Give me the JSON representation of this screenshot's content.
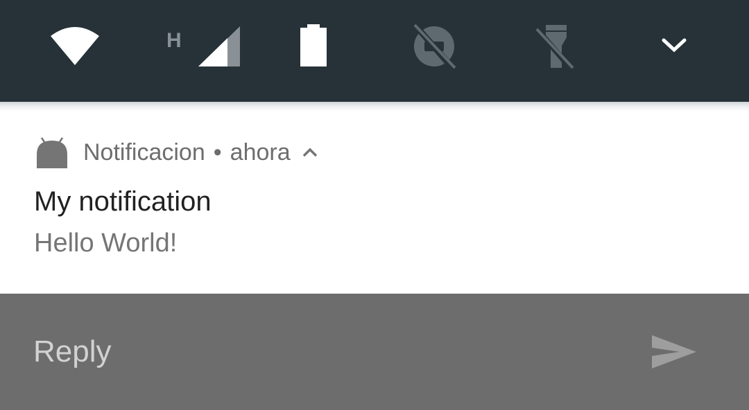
{
  "quick_settings": {
    "tiles": [
      {
        "name": "wifi",
        "icon": "wifi-icon",
        "state": "on"
      },
      {
        "name": "mobile-data",
        "icon": "cell-signal-icon",
        "network_type": "H",
        "state": "on"
      },
      {
        "name": "battery",
        "icon": "battery-icon",
        "state": "on"
      },
      {
        "name": "auto-rotate",
        "icon": "rotation-lock-icon",
        "state": "off"
      },
      {
        "name": "flashlight",
        "icon": "flashlight-off-icon",
        "state": "off"
      }
    ],
    "network_type": "H",
    "expand_icon": "chevron-down-icon",
    "colors": {
      "background": "#263238",
      "active": "#ffffff",
      "inactive": "#5f6a70"
    }
  },
  "notification": {
    "app_name": "Notificacion",
    "separator": "•",
    "time": "ahora",
    "title": "My notification",
    "text": "Hello World!",
    "app_icon": "android-icon",
    "collapse_icon": "chevron-up-icon"
  },
  "reply": {
    "placeholder": "Reply",
    "send_icon": "send-icon",
    "colors": {
      "background": "#6d6d6d"
    }
  }
}
